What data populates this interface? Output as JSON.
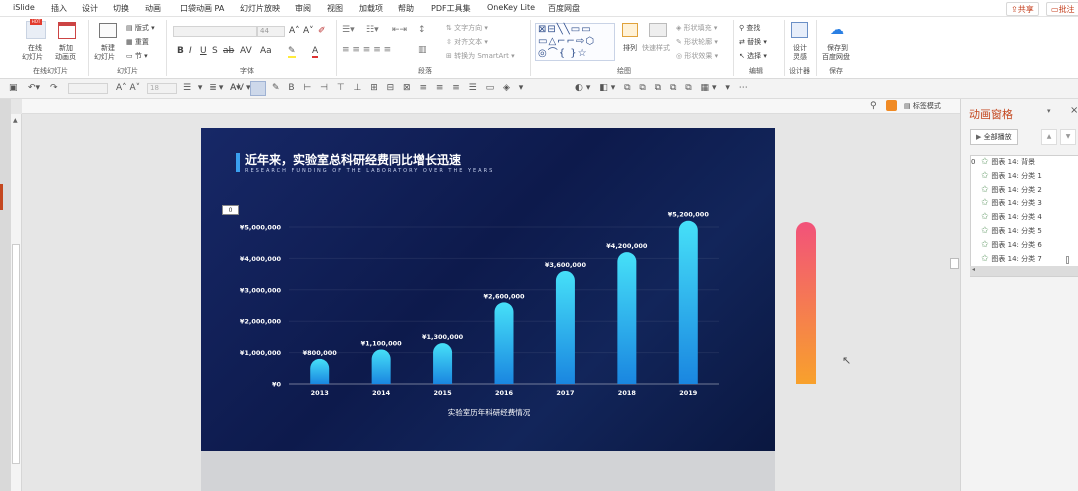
{
  "menu": {
    "items": [
      "iSlide",
      "插入",
      "设计",
      "切换",
      "动画",
      "口袋动画 PA",
      "幻灯片放映",
      "审阅",
      "视图",
      "加载项",
      "帮助",
      "PDF工具集",
      "OneKey Lite",
      "百度网盘"
    ],
    "share": "共享",
    "comment": "批注"
  },
  "ribbon": {
    "online_slides_top": "在线",
    "online_slides_bottom": "幻灯片",
    "new_anim_top": "新加",
    "new_anim_bottom": "动画页",
    "group_online": "在线幻灯片",
    "new_slide_top": "新建",
    "new_slide_bottom": "幻灯片",
    "layout": "版式",
    "reset": "重置",
    "section": "节",
    "group_slides": "幻灯片",
    "font_size": "44",
    "group_font": "字体",
    "text_direction": "文字方向",
    "align_text": "对齐文本",
    "convert_smartart": "转换为 SmartArt",
    "group_paragraph": "段落",
    "arrange": "排列",
    "quick_styles": "快速样式",
    "shape_fill": "形状填充",
    "shape_outline": "形状轮廓",
    "shape_effects": "形状效果",
    "group_drawing": "绘图",
    "find": "查找",
    "replace": "替换",
    "select": "选择",
    "group_editing": "编辑",
    "designer_top": "设计",
    "designer_bottom": "灵感",
    "group_designer": "设计器",
    "save_baidu_top": "保存到",
    "save_baidu_bottom": "百度网盘",
    "group_save": "保存"
  },
  "qat": {
    "font_size": "18"
  },
  "view_toggle": "标签模式",
  "slide": {
    "title": "近年来，实验室总科研经费同比增长迅速",
    "subtitle": "RESEARCH FUNDING OF THE LABORATORY OVER THE YEARS",
    "zero_badge": "0",
    "accent_color": "#3aa0f0"
  },
  "chart_data": {
    "type": "bar",
    "categories": [
      "2013",
      "2014",
      "2015",
      "2016",
      "2017",
      "2018",
      "2019"
    ],
    "values": [
      800000,
      1100000,
      1300000,
      2600000,
      3600000,
      4200000,
      5200000
    ],
    "data_labels": [
      "¥800,000",
      "¥1,100,000",
      "¥1,300,000",
      "¥2,600,000",
      "¥3,600,000",
      "¥4,200,000",
      "¥5,200,000"
    ],
    "xlabel": "实验室历年科研经费情况",
    "ylabel": "",
    "ylim": [
      0,
      5000000
    ],
    "yticks": [
      0,
      1000000,
      2000000,
      3000000,
      4000000,
      5000000
    ],
    "ytick_labels": [
      "¥0",
      "¥1,000,000",
      "¥2,000,000",
      "¥3,000,000",
      "¥4,000,000",
      "¥5,000,000"
    ],
    "bar_gradient": [
      "#46e0f8",
      "#1a86e0"
    ],
    "grid": true
  },
  "side_bar": {
    "gradient_top": "#f2527a",
    "gradient_bottom": "#f8a12c"
  },
  "anim_pane": {
    "title": "动画窗格",
    "play_all": "全部播放",
    "items": [
      {
        "index": "0",
        "label": "图表 14: 背景"
      },
      {
        "index": "",
        "label": "图表 14: 分类 1"
      },
      {
        "index": "",
        "label": "图表 14: 分类 2"
      },
      {
        "index": "",
        "label": "图表 14: 分类 3"
      },
      {
        "index": "",
        "label": "图表 14: 分类 4"
      },
      {
        "index": "",
        "label": "图表 14: 分类 5"
      },
      {
        "index": "",
        "label": "图表 14: 分类 6"
      },
      {
        "index": "",
        "label": "图表 14: 分类 7"
      }
    ]
  }
}
